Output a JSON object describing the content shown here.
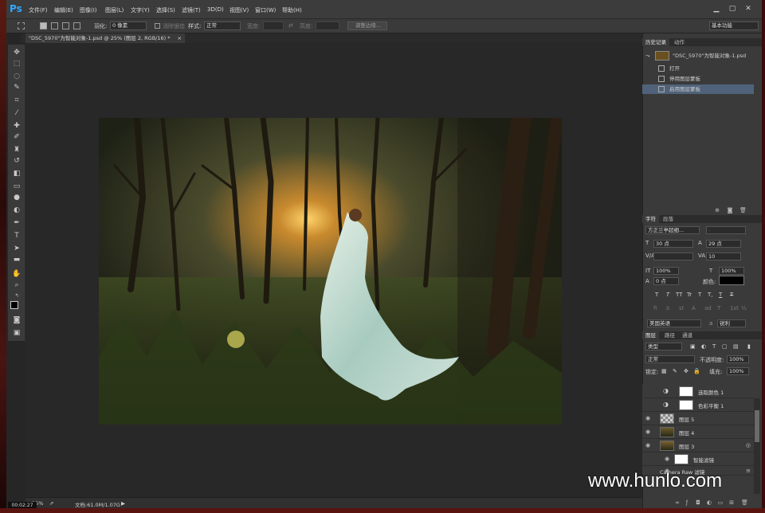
{
  "app": {
    "logo": "Ps"
  },
  "menu": [
    "文件(F)",
    "编辑(E)",
    "图像(I)",
    "图层(L)",
    "文字(Y)",
    "选择(S)",
    "滤镜(T)",
    "3D(D)",
    "视图(V)",
    "窗口(W)",
    "帮助(H)"
  ],
  "window_controls": {
    "minimize": "▁",
    "restore": "▢",
    "close": "✕"
  },
  "options": {
    "feather_label": "羽化:",
    "feather_value": "0 像素",
    "antialias_label": "消除锯齿",
    "style_label": "样式:",
    "style_value": "正常",
    "width_label": "宽度:",
    "height_label": "高度:",
    "refine_button": "调整边缘...",
    "workspace": "基本功能"
  },
  "document": {
    "tab_title": "\"DSC_5970\"为智能对象-1.psd @ 25% (图层 2, RGB/16) *",
    "close": "×"
  },
  "status": {
    "zoom": "25%",
    "doc_info": "文档:61.0M/1.07G",
    "time": "00:02:27"
  },
  "history": {
    "tabs": [
      "历史记录",
      "动作"
    ],
    "snapshot": "\"DSC_5970\"为智能对象-1.psd",
    "items": [
      "打开",
      "停用图层蒙板",
      "启用图层蒙板"
    ]
  },
  "character": {
    "tabs": [
      "字符",
      "段落"
    ],
    "font_family": "方正兰亭超细...",
    "font_style": "-",
    "size": "30 点",
    "leading": "29 点",
    "tracking": "10",
    "vscale": "100%",
    "hscale": "100%",
    "baseline": "0 点",
    "color_label": "颜色:",
    "language": "美国英语",
    "antialias": "锐利",
    "style_buttons": [
      "T",
      "T",
      "TT",
      "Tr",
      "T",
      "T,",
      "T",
      "T"
    ]
  },
  "layers": {
    "tabs": [
      "图层",
      "路径",
      "通道"
    ],
    "filter": "类型",
    "blend_mode": "正常",
    "opacity_label": "不透明度:",
    "opacity": "100%",
    "lock_label": "锁定:",
    "fill_label": "填充:",
    "fill": "100%",
    "items": [
      {
        "name": "选取颜色 1"
      },
      {
        "name": "色彩平衡 1"
      },
      {
        "name": "图层 5"
      },
      {
        "name": "图层 4"
      },
      {
        "name": "图层 3"
      },
      {
        "name": "智能滤镜"
      },
      {
        "name": "Camera Raw 滤镜"
      }
    ]
  },
  "watermark": "www.hunlo.com",
  "colors": {
    "accent": "#31a8ff",
    "selection": "#50627a",
    "panel": "#3a3a3a"
  }
}
